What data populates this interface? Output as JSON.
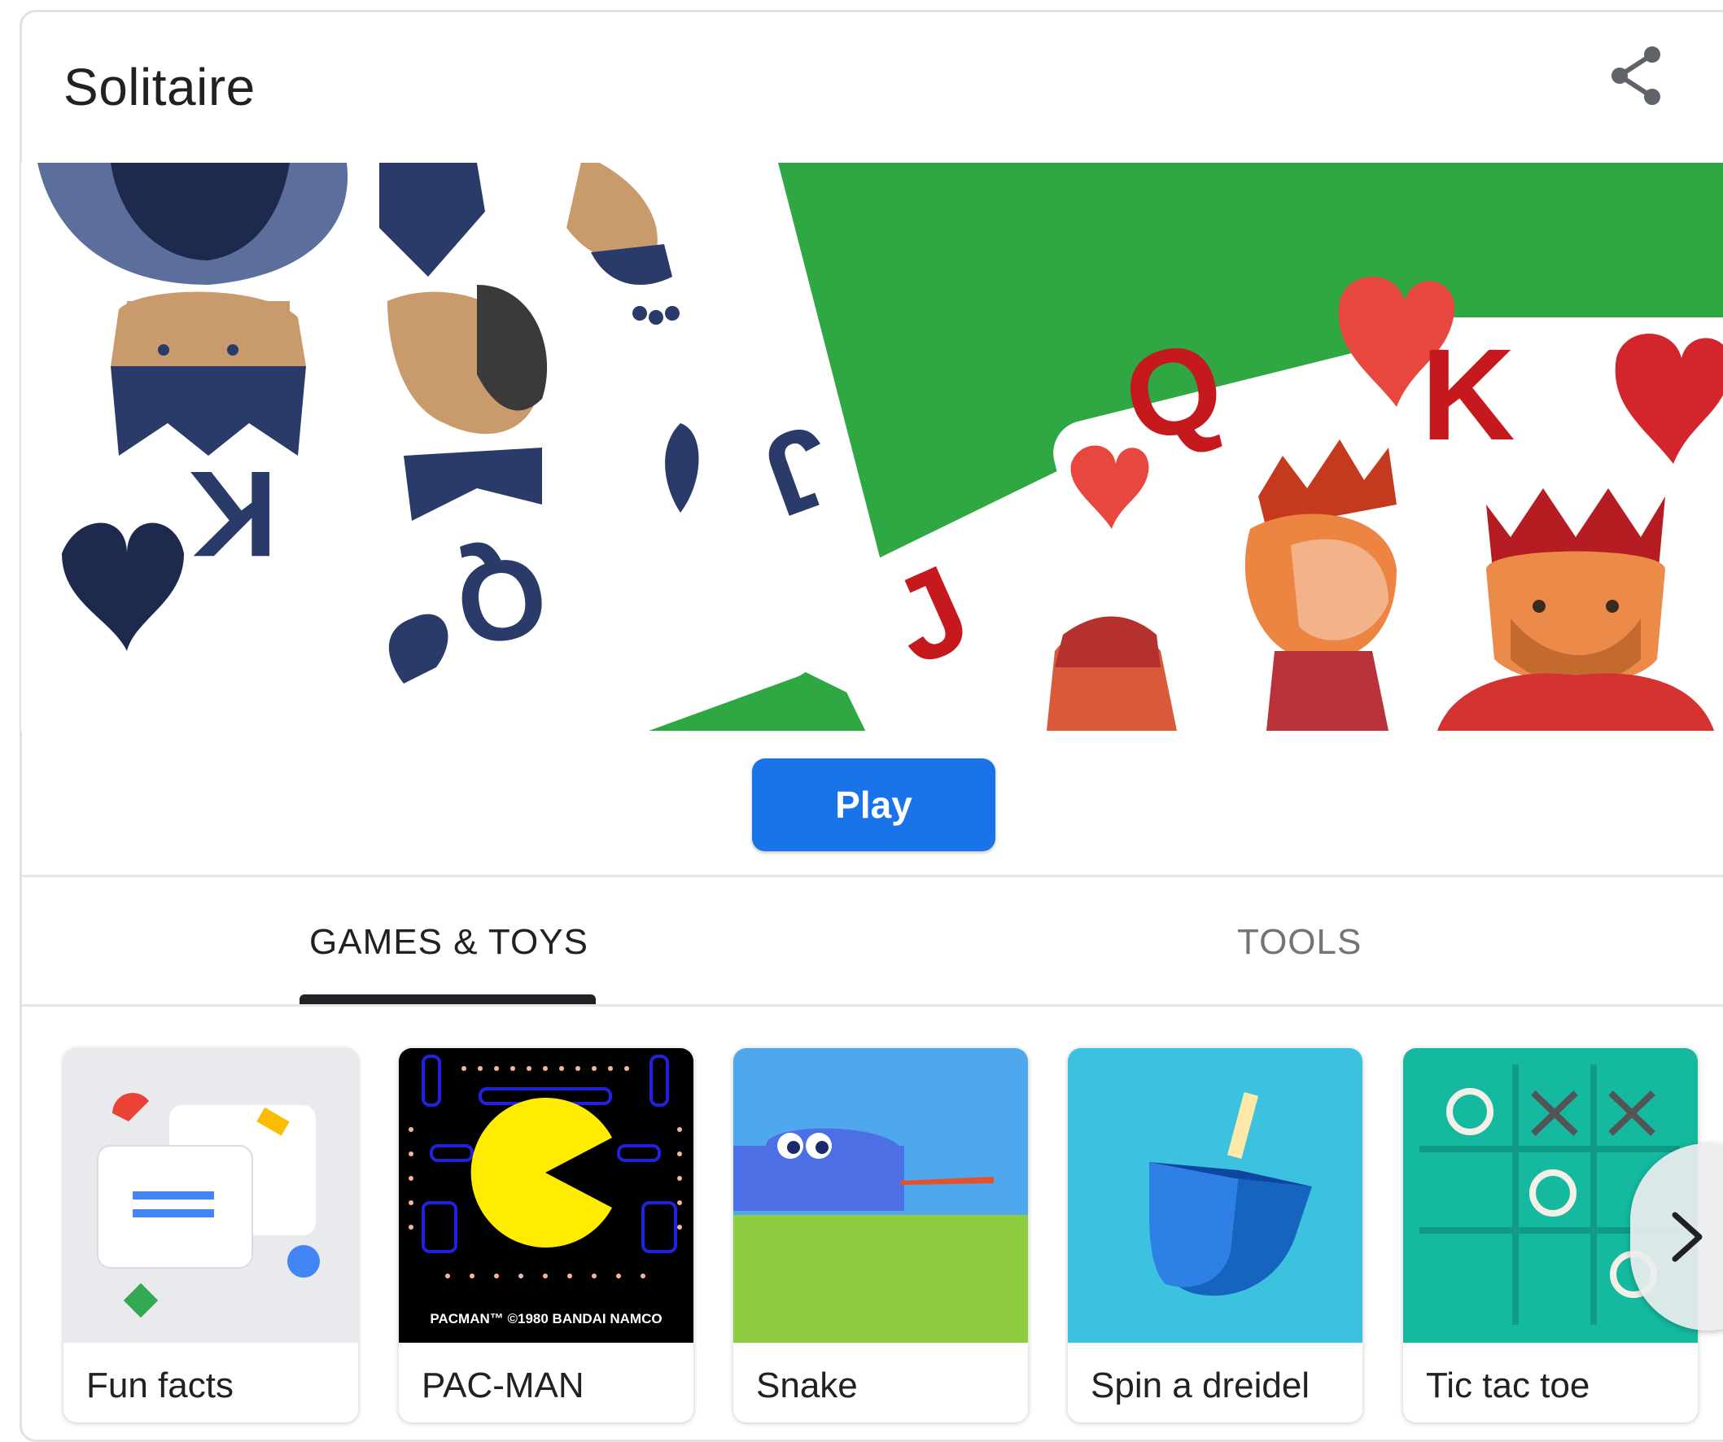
{
  "header": {
    "title": "Solitaire",
    "share_icon": "share-icon"
  },
  "hero": {
    "image": "solitaire-cards-illustration",
    "colors": {
      "felt": "#2fa844",
      "black_suit": "#2a3b6a",
      "red_suit": "#c5191e"
    }
  },
  "play_button": {
    "label": "Play",
    "color": "#1a73e8"
  },
  "tabs": [
    {
      "label": "GAMES & TOYS",
      "selected": true
    },
    {
      "label": "TOOLS",
      "selected": false
    }
  ],
  "tiles": [
    {
      "label": "Fun facts",
      "icon": "fun-facts-icon"
    },
    {
      "label": "PAC-MAN",
      "icon": "pacman-icon",
      "caption": "PACMAN™ ©1980 BANDAI NAMCO"
    },
    {
      "label": "Snake",
      "icon": "snake-icon"
    },
    {
      "label": "Spin a dreidel",
      "icon": "dreidel-icon"
    },
    {
      "label": "Tic tac toe",
      "icon": "tic-tac-toe-icon"
    }
  ],
  "carousel": {
    "next_icon": "chevron-right-icon"
  }
}
